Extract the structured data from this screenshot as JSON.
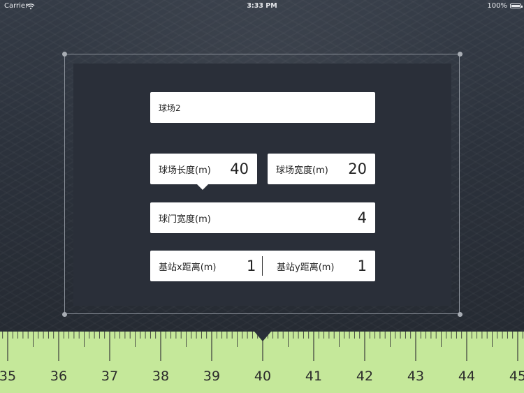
{
  "status_bar": {
    "carrier": "Carrier",
    "time": "3:33 PM",
    "battery": "100%",
    "icons": [
      "wifi-icon",
      "battery-icon"
    ]
  },
  "form": {
    "name": "球场2",
    "field_length": {
      "label": "球场长度(m)",
      "value": "40"
    },
    "field_width": {
      "label": "球场宽度(m)",
      "value": "20"
    },
    "goal_width": {
      "label": "球门宽度(m)",
      "value": "4"
    },
    "base_x": {
      "label": "基站x距离(m)",
      "value": "1"
    },
    "base_y": {
      "label": "基站y距离(m)",
      "value": "1"
    }
  },
  "ruler": {
    "selected_value": 40,
    "visible_range": [
      35,
      45
    ],
    "labels": [
      "35",
      "36",
      "37",
      "38",
      "39",
      "40",
      "41",
      "42",
      "43",
      "44",
      "45"
    ],
    "minor_per_major": 10,
    "color": "#c5e89a"
  },
  "colors": {
    "panel": "#2a2f39",
    "field_bg": "#ffffff",
    "ruler": "#c5e89a"
  }
}
